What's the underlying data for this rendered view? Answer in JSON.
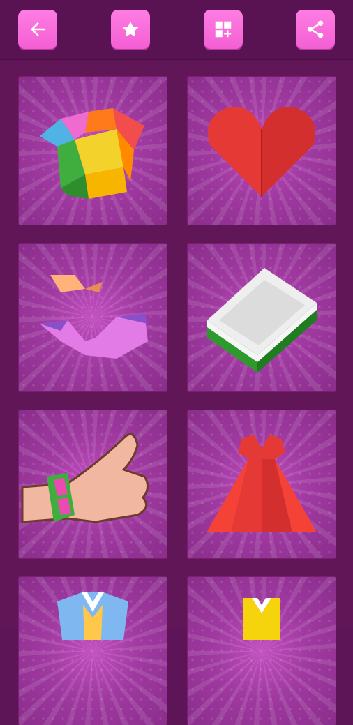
{
  "toolbar": {
    "icons": [
      "back-arrow-icon",
      "star-icon",
      "add-widget-icon",
      "share-icon"
    ],
    "button_color": "#f96bdb"
  },
  "grid": {
    "items": [
      {
        "subject": "origami-crown"
      },
      {
        "subject": "origami-heart"
      },
      {
        "subject": "origami-bikini"
      },
      {
        "subject": "origami-box"
      },
      {
        "subject": "origami-bracelet"
      },
      {
        "subject": "origami-dress"
      },
      {
        "subject": "origami-kimono"
      },
      {
        "subject": "origami-shirt"
      }
    ]
  },
  "colors": {
    "background": "#5e1557",
    "tile": "#a03aa1"
  }
}
